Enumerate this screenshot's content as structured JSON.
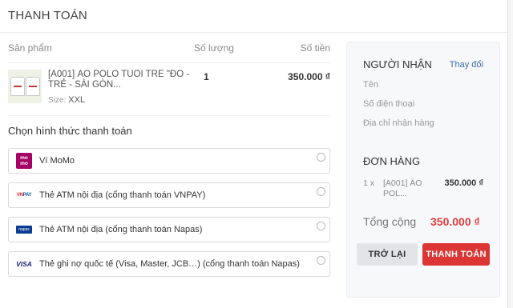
{
  "header": {
    "title": "THANH TOÁN"
  },
  "cart": {
    "columns": {
      "product": "Sản phẩm",
      "quantity": "Số lượng",
      "amount": "Số tiền"
    },
    "item": {
      "name": "[A001] ÁO POLO TUỔI TRẺ \"ĐỎ - TRẺ - SÀI GÒN...",
      "size_label": "Size:",
      "size_value": "XXL",
      "quantity": "1",
      "price": "350.000 ₫"
    }
  },
  "payment": {
    "title": "Chọn hình thức thanh toán",
    "methods": [
      {
        "label": "Ví MoMo",
        "icon": "momo-logo"
      },
      {
        "label": "Thẻ ATM nội địa (cổng thanh toán VNPAY)",
        "icon": "vnpay-logo"
      },
      {
        "label": "Thẻ ATM nội địa (cổng thanh toán Napas)",
        "icon": "napas-logo"
      },
      {
        "label": "Thẻ ghi nợ quốc tế (Visa, Master, JCB…) (cổng thanh toán Napas)",
        "icon": "visa-logo"
      }
    ]
  },
  "logos": {
    "momo": "mo mo",
    "vnpay_a": "VN",
    "vnpay_b": "PAY",
    "napas": "napas",
    "visa": "VISA"
  },
  "recipient": {
    "title": "NGƯỜI NHẬN",
    "change_link": "Thay đổi",
    "name_placeholder": "Tên",
    "phone_placeholder": "Số điện thoại",
    "address_placeholder": "Địa chỉ nhận hàng"
  },
  "order": {
    "title": "ĐƠN HÀNG",
    "item_qty": "1 x",
    "item_name": "[A001] ÁO POL...",
    "item_price": "350.000 ₫",
    "total_label": "Tổng cộng",
    "total_value": "350.000 ₫"
  },
  "actions": {
    "back": "TRỞ LẠI",
    "pay": "THANH TOÁN"
  },
  "colors": {
    "accent": "#db3534",
    "link": "#3a6ea8",
    "momo": "#a50064"
  }
}
